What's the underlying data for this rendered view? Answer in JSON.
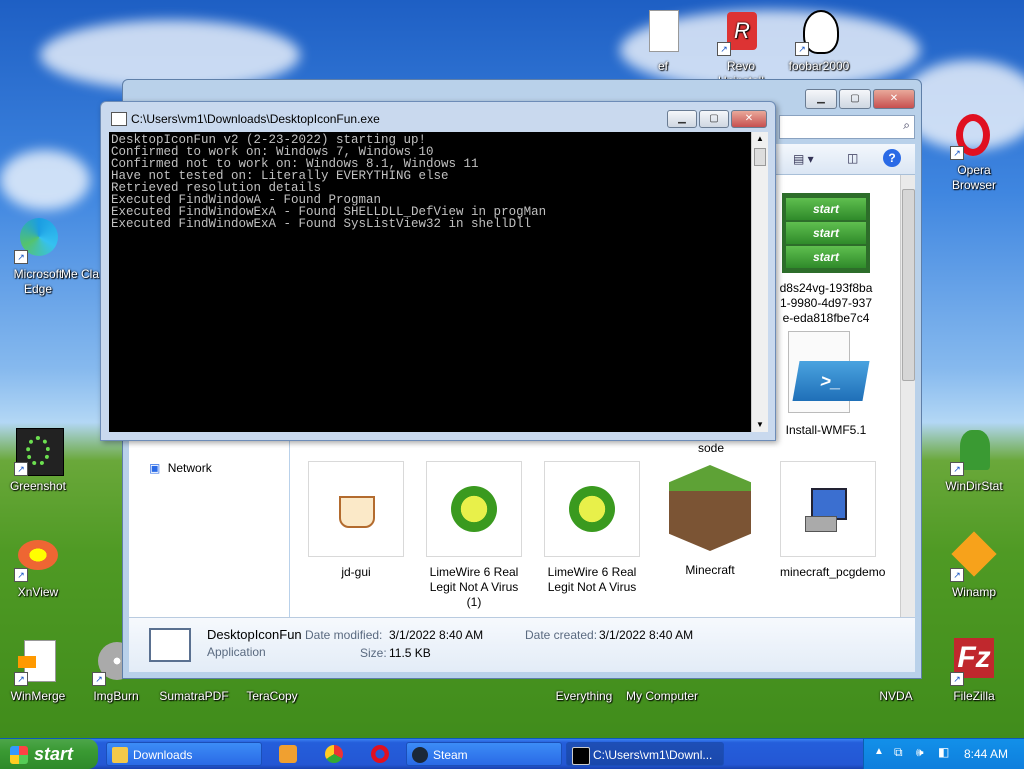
{
  "desktop_icons": [
    {
      "label": "ef",
      "icon": "document-icon"
    },
    {
      "label": "Revo Uninstall",
      "icon": "revo-icon"
    },
    {
      "label": "foobar2000",
      "icon": "foobar-icon"
    },
    {
      "label": "Opera Browser",
      "icon": "opera-icon"
    },
    {
      "label": "Microsoft Edge",
      "icon": "edge-icon"
    },
    {
      "label": "Me Cla",
      "icon": "partial-icon"
    },
    {
      "label": "Greenshot",
      "icon": "greenshot-icon"
    },
    {
      "label": "WinDirStat",
      "icon": "windirstat-icon"
    },
    {
      "label": "XnView",
      "icon": "xnview-icon"
    },
    {
      "label": "Winamp",
      "icon": "winamp-icon"
    },
    {
      "label": "WinMerge",
      "icon": "winmerge-icon"
    },
    {
      "label": "ImgBurn",
      "icon": "imgburn-icon"
    },
    {
      "label": "SumatraPDF",
      "icon": "sumatra-icon"
    },
    {
      "label": "TeraCopy",
      "icon": "teracopy-icon"
    },
    {
      "label": "Everything",
      "icon": "everything-icon"
    },
    {
      "label": "My Computer",
      "icon": "computer-icon"
    },
    {
      "label": "NVDA",
      "icon": "nvda-icon"
    },
    {
      "label": "FileZilla",
      "icon": "filezilla-icon"
    }
  ],
  "console": {
    "title": "C:\\Users\\vm1\\Downloads\\DesktopIconFun.exe",
    "lines": [
      "DesktopIconFun v2 (2-23-2022) starting up!",
      "Confirmed to work on: Windows 7, Windows 10",
      "Confirmed not to work on: Windows 8.1, Windows 11",
      "Have not tested on: Literally EVERYTHING else",
      "Retrieved resolution details",
      "Executed FindWindowA - Found Progman",
      "Executed FindWindowExA - Found SHELLDLL_DefView in progMan",
      "Executed FindWindowExA - Found SysListView32 in shellDll"
    ]
  },
  "explorer": {
    "nav_network": "Network",
    "tiles_top": [
      {
        "label": "d8s24vg-193f8ba1-9980-4d97-937e-eda818fbe7c4",
        "icon": "xp-start-image-icon"
      },
      {
        "label": "Install-WMF5.1",
        "icon": "powershell-file-icon"
      }
    ],
    "partial_label": "sode",
    "tiles": [
      {
        "label": "jd-gui",
        "icon": "java-icon"
      },
      {
        "label": "LimeWire 6 Real Legit Not A Virus (1)",
        "icon": "limewire-icon"
      },
      {
        "label": "LimeWire 6 Real Legit Not A Virus",
        "icon": "limewire-icon"
      },
      {
        "label": "Minecraft",
        "icon": "minecraft-icon"
      },
      {
        "label": "minecraft_pcgdemo",
        "icon": "installer-icon"
      }
    ],
    "start_label": "start",
    "details": {
      "name": "DesktopIconFun",
      "type": "Application",
      "modified_label": "Date modified:",
      "modified_value": "3/1/2022 8:40 AM",
      "created_label": "Date created:",
      "created_value": "3/1/2022 8:40 AM",
      "size_label": "Size:",
      "size_value": "11.5 KB"
    }
  },
  "taskbar": {
    "start_label": "start",
    "buttons": [
      {
        "label": "Downloads"
      },
      {
        "label": "Steam"
      },
      {
        "label": "C:\\Users\\vm1\\Downl..."
      }
    ],
    "clock": "8:44 AM"
  },
  "colors": {
    "xp_blue": "#245edb",
    "start_green": "#3a9a33",
    "console_bg": "#000000",
    "console_text": "#c0c0c0"
  }
}
